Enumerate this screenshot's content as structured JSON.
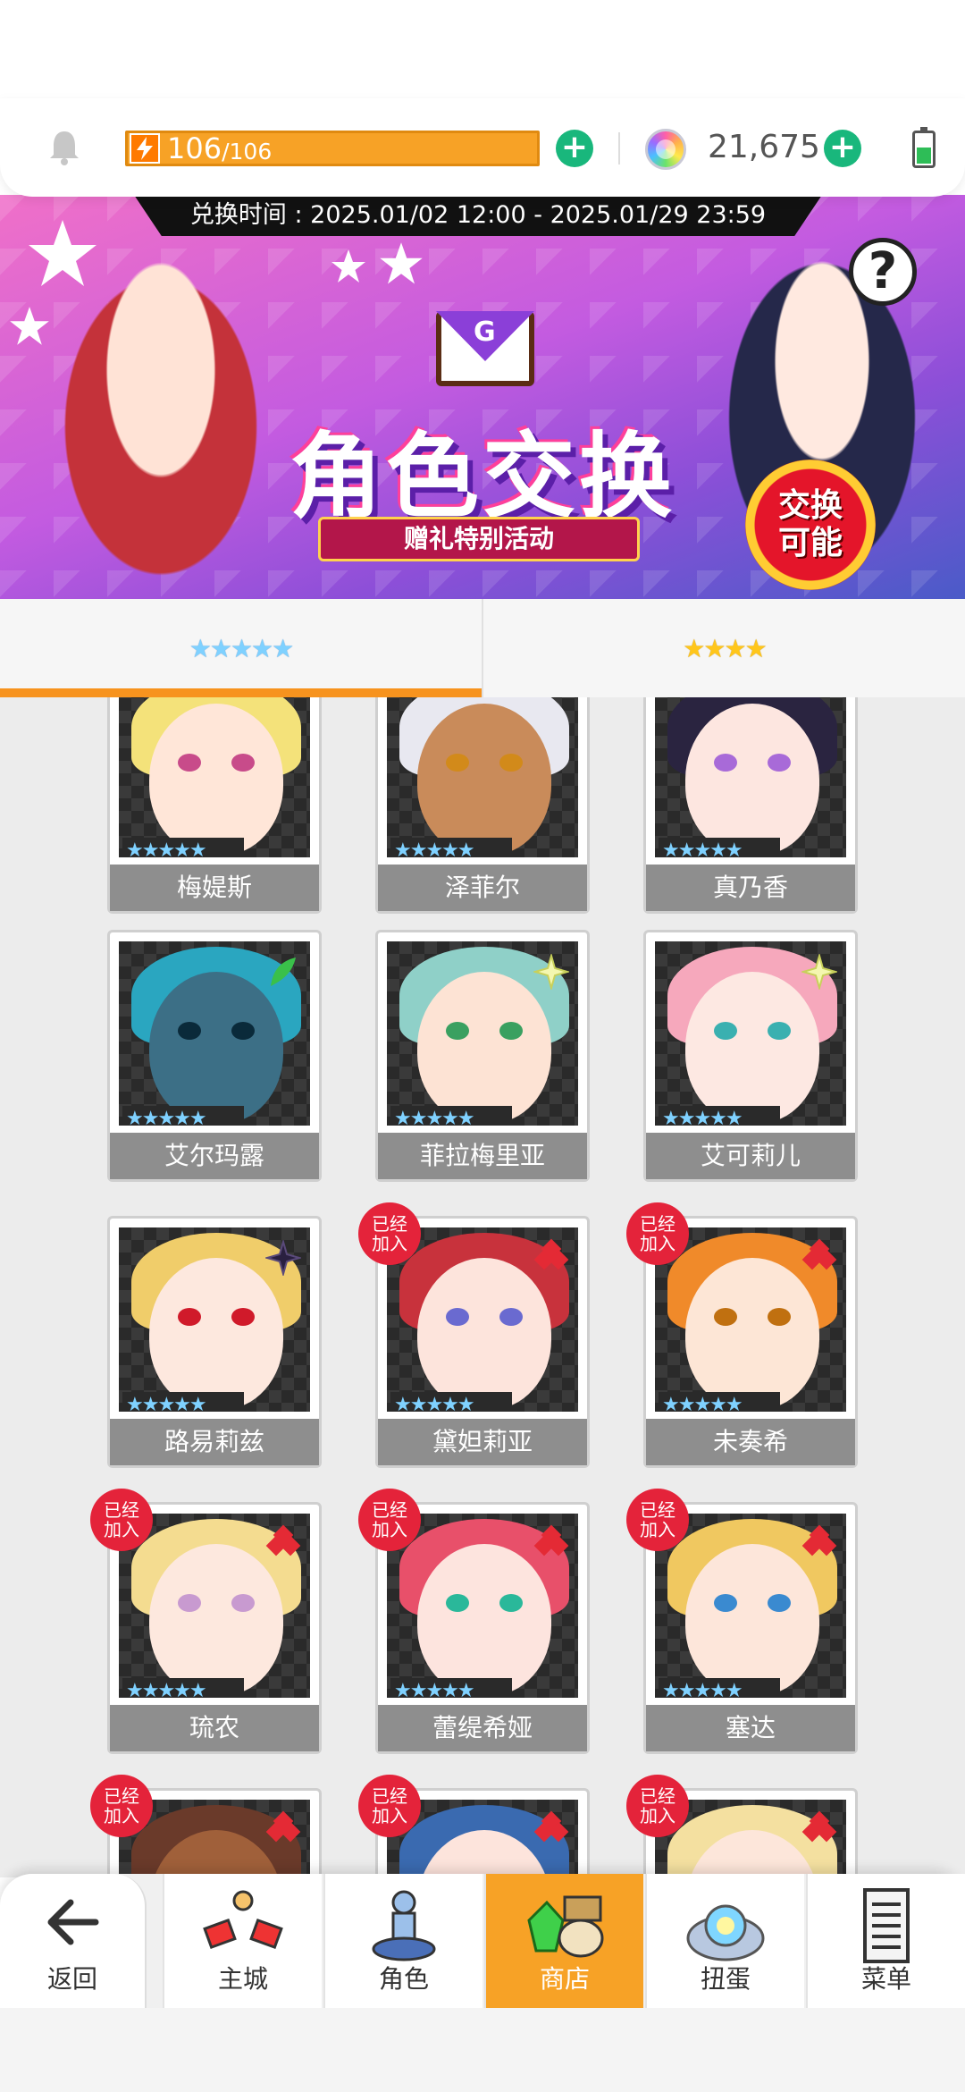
{
  "status_bar": {
    "stamina_value": "106",
    "stamina_max": "/106",
    "gem_value": "21,675"
  },
  "banner": {
    "exchange_time": "兑换时间 : 2025.01/02 12:00 - 2025.01/29 23:59",
    "title": "角色交换",
    "subtitle": "赠礼特别活动",
    "badge_line1": "交换",
    "badge_line2": "可能",
    "help_label": "?",
    "envelope_letter": "G"
  },
  "tabs": [
    {
      "label": "★★★★★",
      "active": true
    },
    {
      "label": "★★★★",
      "active": false
    }
  ],
  "card_common": {
    "stars": "★★★★★",
    "joined_line1": "已经",
    "joined_line2": "加入"
  },
  "characters": [
    {
      "name": "梅媞斯",
      "joined": false,
      "element": "none",
      "hair": "#f4e27a",
      "skin": "#ffe6d8",
      "eye": "#c84b8a"
    },
    {
      "name": "泽菲尔",
      "joined": false,
      "element": "none",
      "hair": "#e8e8f0",
      "skin": "#c98b5a",
      "eye": "#d28a1a"
    },
    {
      "name": "真乃香",
      "joined": false,
      "element": "none",
      "hair": "#2a2440",
      "skin": "#fde6e0",
      "eye": "#a86ad8"
    },
    {
      "name": "艾尔玛露",
      "joined": false,
      "element": "leaf",
      "hair": "#2aa6c0",
      "skin": "#3c6f86",
      "eye": "#0a2a3a"
    },
    {
      "name": "菲拉梅里亚",
      "joined": false,
      "element": "sparkle",
      "hair": "#8fd0c8",
      "skin": "#fde3d4",
      "eye": "#3aa060"
    },
    {
      "name": "艾可莉儿",
      "joined": false,
      "element": "sparkle",
      "hair": "#f6a8bc",
      "skin": "#fde8e2",
      "eye": "#3ab0b0"
    },
    {
      "name": "路易莉兹",
      "joined": false,
      "element": "dark",
      "hair": "#f0cd6a",
      "skin": "#fde8de",
      "eye": "#d01a2a"
    },
    {
      "name": "黛妲莉亚",
      "joined": true,
      "element": "fire",
      "hair": "#c8323c",
      "skin": "#fde4dc",
      "eye": "#6a6ad0"
    },
    {
      "name": "未奏希",
      "joined": true,
      "element": "fire",
      "hair": "#f08a2a",
      "skin": "#fde6d6",
      "eye": "#c07010"
    },
    {
      "name": "琉农",
      "joined": true,
      "element": "fire",
      "hair": "#f4dc90",
      "skin": "#fde8de",
      "eye": "#c89ad0"
    },
    {
      "name": "蕾缇希娅",
      "joined": true,
      "element": "fire",
      "hair": "#e8506a",
      "skin": "#fde4de",
      "eye": "#2ab89a"
    },
    {
      "name": "塞达",
      "joined": true,
      "element": "fire",
      "hair": "#f0c860",
      "skin": "#fde6da",
      "eye": "#3a8ad0"
    },
    {
      "name": "",
      "joined": true,
      "element": "fire",
      "hair": "#6a3a2a",
      "skin": "#a0603a",
      "eye": "#222"
    },
    {
      "name": "",
      "joined": true,
      "element": "fire",
      "hair": "#3a6ab0",
      "skin": "#fde4dc",
      "eye": "#222"
    },
    {
      "name": "",
      "joined": true,
      "element": "fire",
      "hair": "#f4e0a0",
      "skin": "#fde6da",
      "eye": "#222"
    }
  ],
  "nav": {
    "back": "返回",
    "home": "主城",
    "character": "角色",
    "shop": "商店",
    "gacha": "扭蛋",
    "menu": "菜单"
  },
  "colors": {
    "accent_orange": "#f7a226",
    "plus_green": "#19b77c",
    "joined_red": "#e4233a",
    "namebar_gray": "#8e8e8e"
  }
}
